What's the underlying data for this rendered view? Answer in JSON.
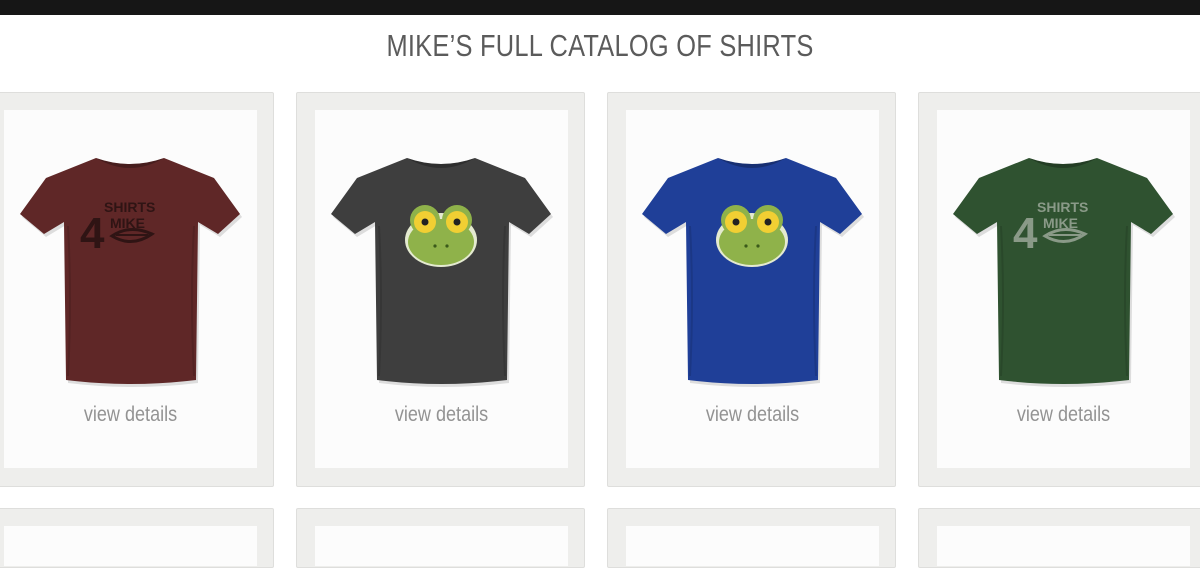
{
  "page": {
    "title": "MIKE’S FULL CATALOG OF SHIRTS"
  },
  "colors": {
    "top_bar": "#161616",
    "title_text": "#5b5b5b",
    "card_frame": "#eeeeec",
    "card_inner": "#fcfcfc",
    "link_text": "#939393"
  },
  "products": [
    {
      "color_name": "maroon",
      "shirt_color": "#5f2727",
      "design": "shirts4mike-logo",
      "design_color": "#2f1414",
      "view_label": "view details"
    },
    {
      "color_name": "charcoal",
      "shirt_color": "#3e3e3e",
      "design": "frog-face",
      "design_color": "#8fb24a",
      "view_label": "view details"
    },
    {
      "color_name": "royal-blue",
      "shirt_color": "#1f3f98",
      "design": "frog-face",
      "design_color": "#8fb24a",
      "view_label": "view details"
    },
    {
      "color_name": "forest-green",
      "shirt_color": "#2f5230",
      "design": "shirts4mike-logo",
      "design_color": "#8a9a88",
      "view_label": "view details"
    }
  ],
  "logo_text": {
    "line1": "SHIRTS",
    "numeral": "4",
    "line2": "MIKE"
  }
}
